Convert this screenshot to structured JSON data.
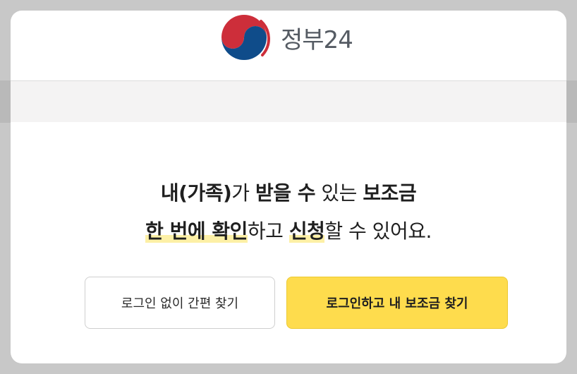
{
  "brand": {
    "name": "정부24",
    "colors": {
      "red": "#cd2e3a",
      "blue": "#0f4c8a",
      "text": "#555b63"
    }
  },
  "headline": {
    "line1": {
      "a": "내(가족)",
      "b": "가 ",
      "c": "받을 수",
      "d": " 있는 ",
      "e": "보조금"
    },
    "line2": {
      "a": "한 번에 확인",
      "b": "하고 ",
      "c": "신청",
      "d": "할 수 있어요."
    }
  },
  "buttons": {
    "guest": "로그인 없이 간편 찾기",
    "login": "로그인하고 내 보조금 찾기",
    "login_color": "#fedc4d"
  }
}
